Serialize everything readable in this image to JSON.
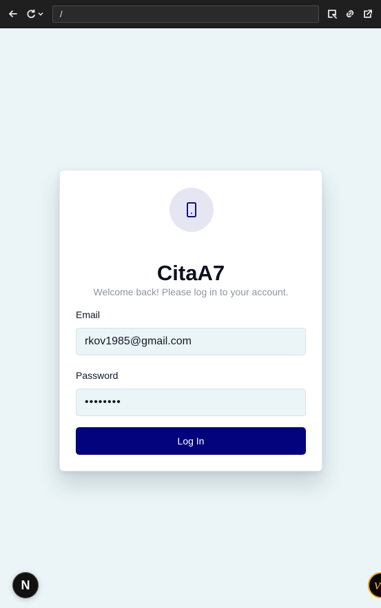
{
  "browser": {
    "address": "/"
  },
  "login": {
    "title": "CitaA7",
    "subtitle": "Welcome back! Please log in to your account.",
    "email_label": "Email",
    "email_value": "rkov1985@gmail.com",
    "password_label": "Password",
    "password_value": "••••••••",
    "button_label": "Log In"
  },
  "badges": {
    "next_letter": "N",
    "corner_letter": "v"
  },
  "icons": {
    "back": "back-arrow-icon",
    "reload": "reload-icon",
    "dropdown": "chevron-down-icon",
    "inspect": "inspect-icon",
    "link": "link-icon",
    "external": "external-link-icon",
    "logo": "tablet-icon"
  },
  "colors": {
    "page_background": "#ebf5f7",
    "primary_button": "#03037d",
    "logo_circle": "#e6e6f3"
  }
}
